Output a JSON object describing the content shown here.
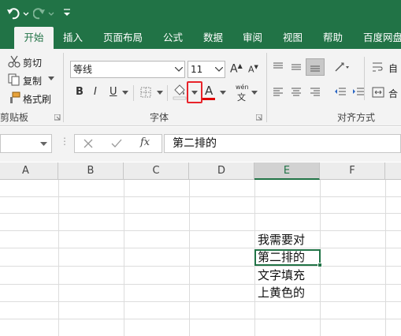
{
  "quick_access": {
    "undo_icon": "undo-icon",
    "redo_icon": "redo-icon",
    "customize_icon": "customize-icon"
  },
  "tabs": [
    {
      "label": "开始",
      "active": true
    },
    {
      "label": "插入"
    },
    {
      "label": "页面布局"
    },
    {
      "label": "公式"
    },
    {
      "label": "数据"
    },
    {
      "label": "审阅"
    },
    {
      "label": "视图"
    },
    {
      "label": "帮助"
    },
    {
      "label": "百度网盘"
    }
  ],
  "clipboard": {
    "cut": "剪切",
    "copy": "复制",
    "format_painter": "格式刷",
    "group_label": "剪贴板"
  },
  "font": {
    "name": "等线",
    "size": "11",
    "grow": "A",
    "shrink": "A",
    "bold": "B",
    "italic": "I",
    "underline": "U",
    "font_color_glyph": "A",
    "phonetic_top": "wén",
    "phonetic_bottom": "文",
    "group_label": "字体"
  },
  "alignment": {
    "group_label": "对齐方式",
    "wrap_label": "自",
    "merge_label": "合"
  },
  "formula_bar": {
    "fx": "fx",
    "content": "第二排的"
  },
  "columns": [
    "A",
    "B",
    "C",
    "D",
    "E",
    "F"
  ],
  "selected_column": "E",
  "cells": [
    {
      "text": "我需要对"
    },
    {
      "text": "第二排的",
      "selected": true
    },
    {
      "text": "文字填充"
    },
    {
      "text": "上黄色的"
    }
  ],
  "colors": {
    "brand": "#217346",
    "highlight": "#e8232a",
    "font_color_bar": "#e00000"
  }
}
